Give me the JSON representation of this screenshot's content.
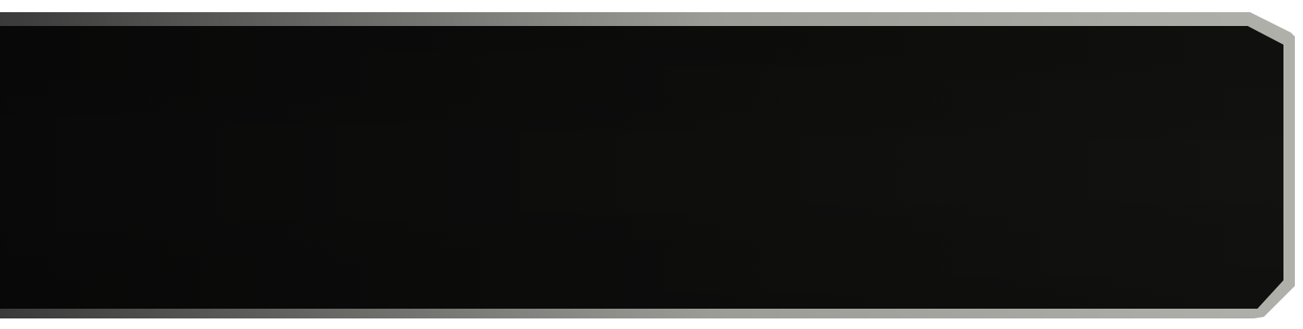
{
  "banner": {
    "label": "",
    "colors": {
      "panel_left": "#090909",
      "panel_right": "#121210",
      "frame_left": "#3a3a3a",
      "frame_right": "#b0b0ab",
      "page_background": "#ffffff"
    }
  }
}
